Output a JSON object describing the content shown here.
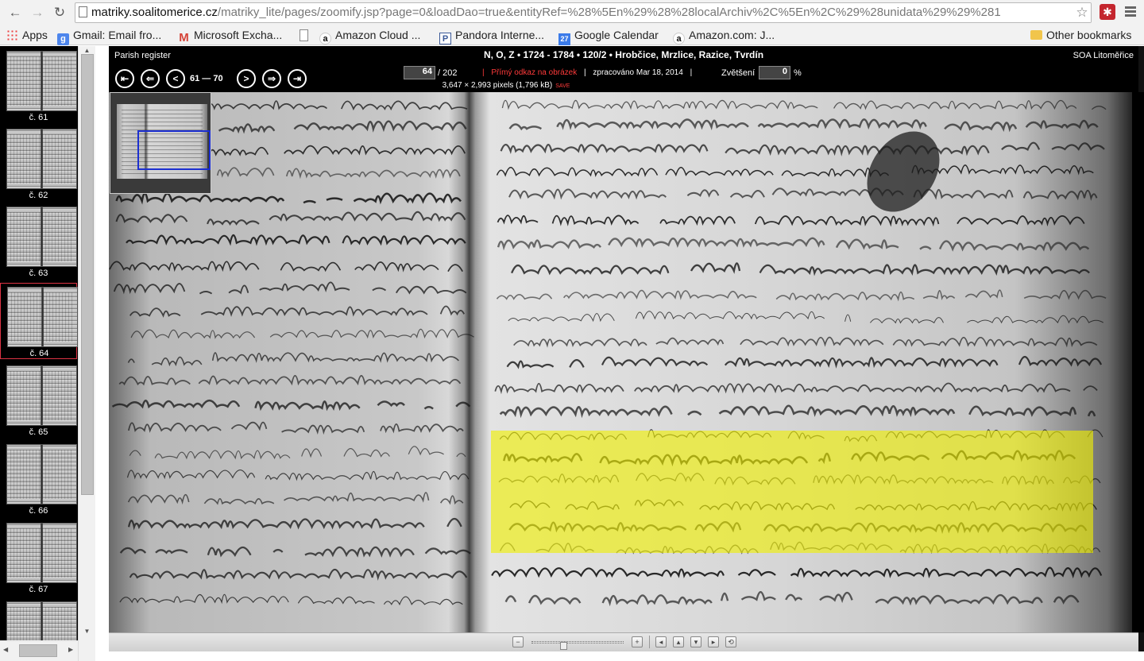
{
  "browser": {
    "back_icon": "arrow-left-icon",
    "forward_icon": "arrow-right-icon",
    "reload_icon": "reload-icon",
    "url_host": "matriky.soalitomerice.cz",
    "url_path": "/matriky_lite/pages/zoomify.jsp?page=0&loadDao=true&entityRef=%28%5En%29%28%28localArchiv%2C%5En%2C%29%28unidata%29%29%281",
    "bookmarks": [
      {
        "label": "Apps",
        "icon": "apps-icon"
      },
      {
        "label": "Gmail: Email fro...",
        "icon": "google-icon"
      },
      {
        "label": "Microsoft Excha...",
        "icon": "gmail-icon"
      },
      {
        "label": "",
        "icon": "document-icon"
      },
      {
        "label": "Amazon Cloud ...",
        "icon": "amazon-icon"
      },
      {
        "label": "Pandora Interne...",
        "icon": "pandora-icon"
      },
      {
        "label": "Google Calendar",
        "icon": "calendar-icon"
      },
      {
        "label": "Amazon.com: J...",
        "icon": "amazon-icon"
      }
    ],
    "other_bookmarks": "Other bookmarks"
  },
  "sidebar": {
    "thumbnails": [
      {
        "label": "č. 61",
        "selected": false
      },
      {
        "label": "č. 62",
        "selected": false
      },
      {
        "label": "č. 63",
        "selected": false
      },
      {
        "label": "č. 64",
        "selected": true
      },
      {
        "label": "č. 65",
        "selected": false
      },
      {
        "label": "č. 66",
        "selected": false
      },
      {
        "label": "č. 67",
        "selected": false
      },
      {
        "label": "",
        "selected": false
      }
    ]
  },
  "viewer": {
    "type_label": "Parish register",
    "title": "N, O, Z • 1724 - 1784 • 120/2 • Hrobčice, Mrzlice, Razice, Tvrdín",
    "archive": "SOA Litoměřice",
    "page_range": "61 — 70",
    "current_page": "64",
    "total_pages": "/ 202",
    "direct_link": "Přímý odkaz na obrázek",
    "processed": "zpracováno Mar 18, 2014",
    "dimensions": "3,647 × 2,993 pixels (1,796 kB)",
    "save_label": "SAVE",
    "zoom_label": "Zvětšení",
    "zoom_value": "0",
    "zoom_unit": "%",
    "highlight_color": "#f0f000"
  }
}
